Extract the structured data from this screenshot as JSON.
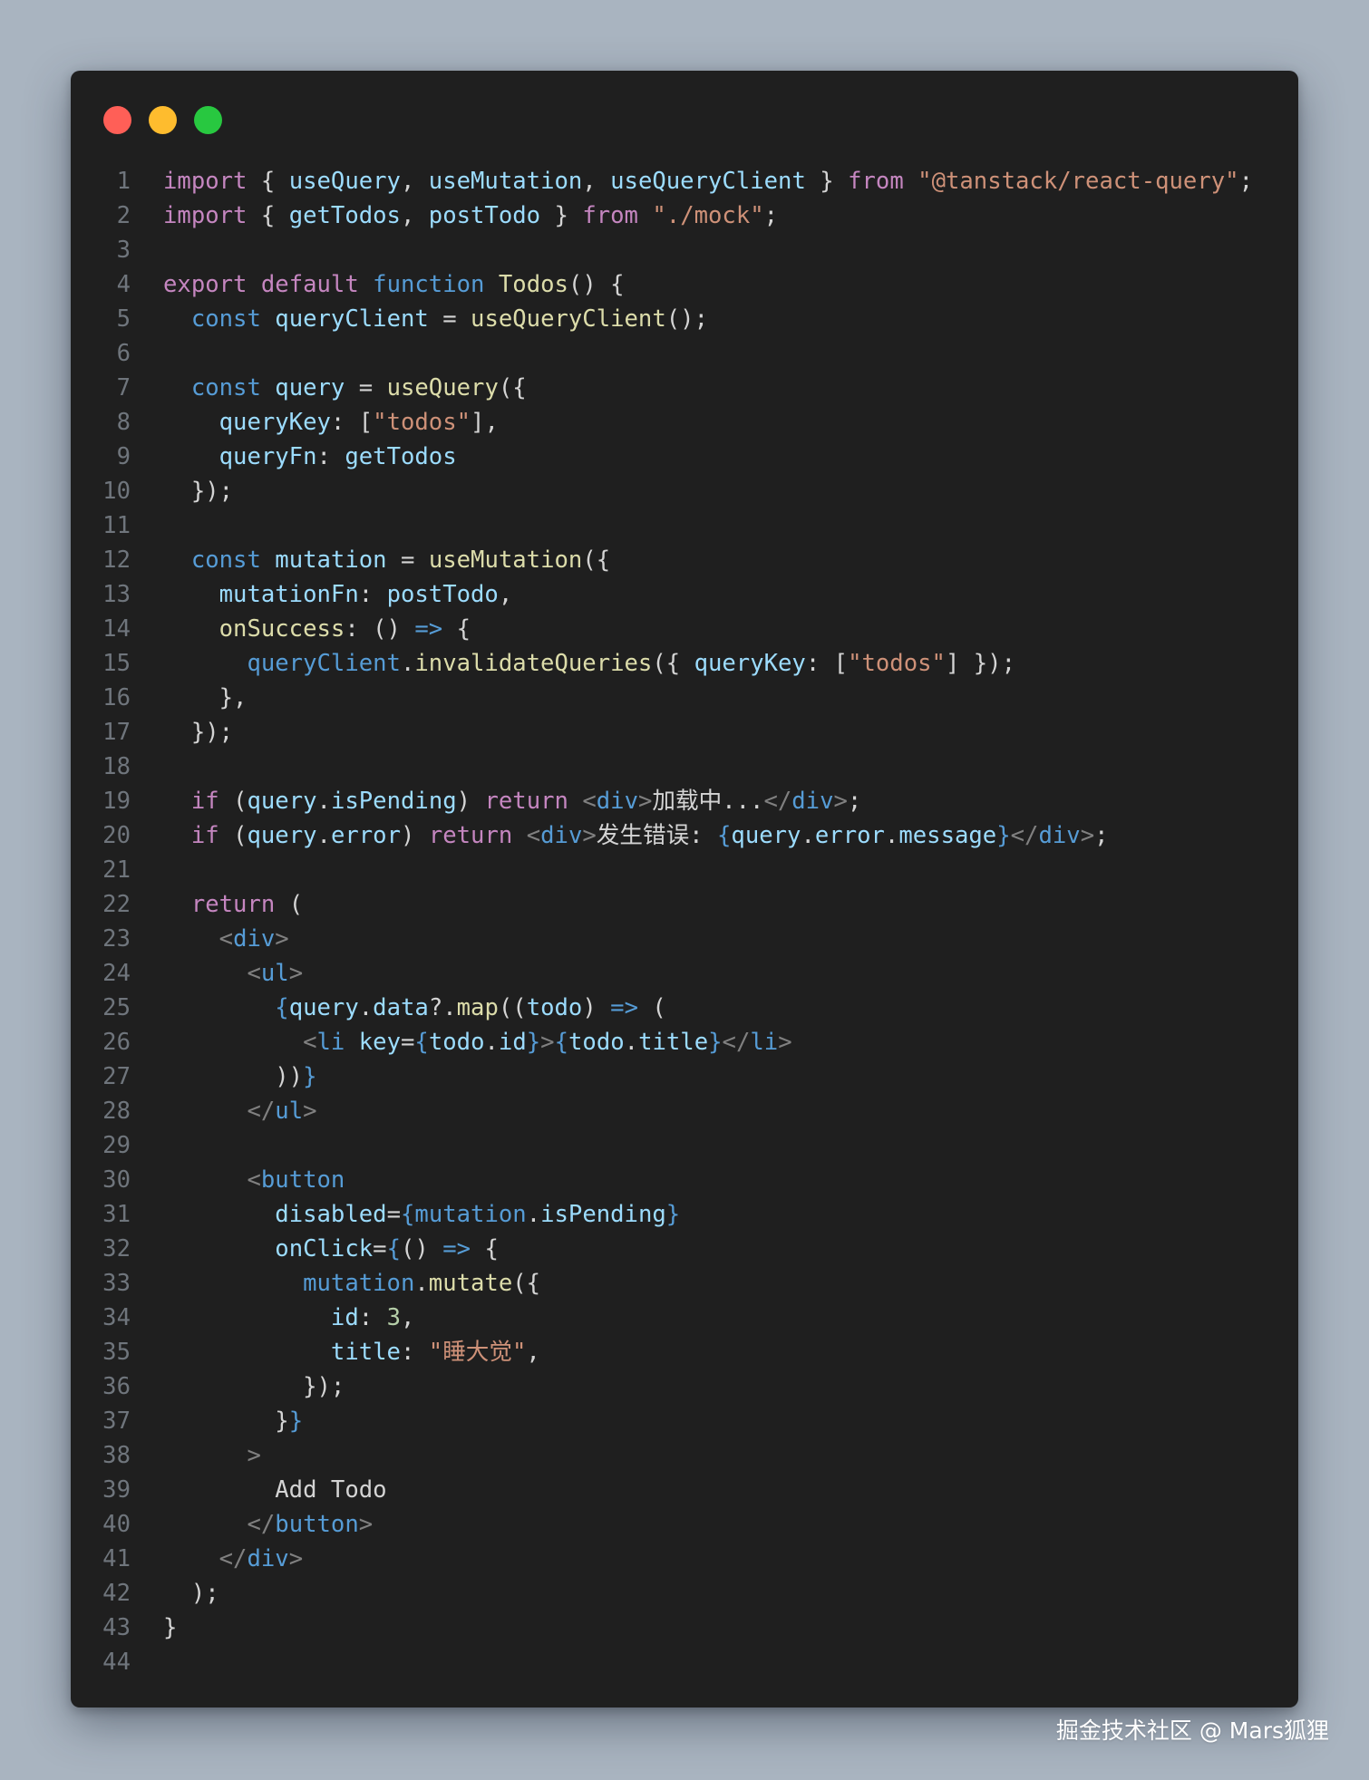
{
  "colors": {
    "keyword": "#c586c0",
    "storage": "#569cd6",
    "variable": "#9cdcfe",
    "function": "#dcdcaa",
    "string": "#ce9178",
    "number": "#b5cea8",
    "punctuation": "#d4d4d4",
    "tag_bracket": "#808080",
    "tag": "#569cd6",
    "jsx_brace": "#569cd6",
    "line_number": "#6f757c",
    "dot_red": "#ff5f57",
    "dot_yellow": "#febc2e",
    "dot_green": "#28c840",
    "window_bg": "#1f1f1f",
    "page_bg": "#a9b4c0"
  },
  "window": {
    "controls": [
      "close",
      "minimize",
      "maximize"
    ]
  },
  "code": {
    "lines": [
      {
        "num": "1",
        "tokens": [
          [
            "kw",
            "import"
          ],
          [
            "p",
            " { "
          ],
          [
            "var",
            "useQuery"
          ],
          [
            "p",
            ", "
          ],
          [
            "var",
            "useMutation"
          ],
          [
            "p",
            ", "
          ],
          [
            "var",
            "useQueryClient"
          ],
          [
            "p",
            " } "
          ],
          [
            "kw",
            "from"
          ],
          [
            "p",
            " "
          ],
          [
            "str",
            "\"@tanstack/react-query\""
          ],
          [
            "p",
            ";"
          ]
        ]
      },
      {
        "num": "2",
        "tokens": [
          [
            "kw",
            "import"
          ],
          [
            "p",
            " { "
          ],
          [
            "var",
            "getTodos"
          ],
          [
            "p",
            ", "
          ],
          [
            "var",
            "postTodo"
          ],
          [
            "p",
            " } "
          ],
          [
            "kw",
            "from"
          ],
          [
            "p",
            " "
          ],
          [
            "str",
            "\"./mock\""
          ],
          [
            "p",
            ";"
          ]
        ]
      },
      {
        "num": "3",
        "tokens": []
      },
      {
        "num": "4",
        "tokens": [
          [
            "kw",
            "export"
          ],
          [
            "p",
            " "
          ],
          [
            "kw",
            "default"
          ],
          [
            "p",
            " "
          ],
          [
            "st",
            "function"
          ],
          [
            "p",
            " "
          ],
          [
            "fn",
            "Todos"
          ],
          [
            "p",
            "() {"
          ]
        ]
      },
      {
        "num": "5",
        "tokens": [
          [
            "p",
            "  "
          ],
          [
            "st",
            "const"
          ],
          [
            "p",
            " "
          ],
          [
            "var",
            "queryClient"
          ],
          [
            "p",
            " = "
          ],
          [
            "fn",
            "useQueryClient"
          ],
          [
            "p",
            "();"
          ]
        ]
      },
      {
        "num": "6",
        "tokens": []
      },
      {
        "num": "7",
        "tokens": [
          [
            "p",
            "  "
          ],
          [
            "st",
            "const"
          ],
          [
            "p",
            " "
          ],
          [
            "var",
            "query"
          ],
          [
            "p",
            " = "
          ],
          [
            "fn",
            "useQuery"
          ],
          [
            "p",
            "({"
          ]
        ]
      },
      {
        "num": "8",
        "tokens": [
          [
            "p",
            "    "
          ],
          [
            "var",
            "queryKey"
          ],
          [
            "p",
            ": ["
          ],
          [
            "str",
            "\"todos\""
          ],
          [
            "p",
            "],"
          ]
        ]
      },
      {
        "num": "9",
        "tokens": [
          [
            "p",
            "    "
          ],
          [
            "var",
            "queryFn"
          ],
          [
            "p",
            ": "
          ],
          [
            "var",
            "getTodos"
          ]
        ]
      },
      {
        "num": "10",
        "tokens": [
          [
            "p",
            "  });"
          ]
        ]
      },
      {
        "num": "11",
        "tokens": []
      },
      {
        "num": "12",
        "tokens": [
          [
            "p",
            "  "
          ],
          [
            "st",
            "const"
          ],
          [
            "p",
            " "
          ],
          [
            "var",
            "mutation"
          ],
          [
            "p",
            " = "
          ],
          [
            "fn",
            "useMutation"
          ],
          [
            "p",
            "({"
          ]
        ]
      },
      {
        "num": "13",
        "tokens": [
          [
            "p",
            "    "
          ],
          [
            "var",
            "mutationFn"
          ],
          [
            "p",
            ": "
          ],
          [
            "var",
            "postTodo"
          ],
          [
            "p",
            ","
          ]
        ]
      },
      {
        "num": "14",
        "tokens": [
          [
            "p",
            "    "
          ],
          [
            "fn",
            "onSuccess"
          ],
          [
            "p",
            ": () "
          ],
          [
            "st",
            "=>"
          ],
          [
            "p",
            " {"
          ]
        ]
      },
      {
        "num": "15",
        "tokens": [
          [
            "p",
            "      "
          ],
          [
            "st",
            "queryClient"
          ],
          [
            "p",
            "."
          ],
          [
            "fn",
            "invalidateQueries"
          ],
          [
            "p",
            "({ "
          ],
          [
            "var",
            "queryKey"
          ],
          [
            "p",
            ": ["
          ],
          [
            "str",
            "\"todos\""
          ],
          [
            "p",
            "] });"
          ]
        ]
      },
      {
        "num": "16",
        "tokens": [
          [
            "p",
            "    },"
          ]
        ]
      },
      {
        "num": "17",
        "tokens": [
          [
            "p",
            "  });"
          ]
        ]
      },
      {
        "num": "18",
        "tokens": []
      },
      {
        "num": "19",
        "tokens": [
          [
            "p",
            "  "
          ],
          [
            "kw",
            "if"
          ],
          [
            "p",
            " ("
          ],
          [
            "var",
            "query"
          ],
          [
            "p",
            "."
          ],
          [
            "var",
            "isPending"
          ],
          [
            "p",
            ") "
          ],
          [
            "kw",
            "return"
          ],
          [
            "p",
            " "
          ],
          [
            "tb",
            "<"
          ],
          [
            "tag",
            "div"
          ],
          [
            "tb",
            ">"
          ],
          [
            "p",
            "加载中..."
          ],
          [
            "tb",
            "</"
          ],
          [
            "tag",
            "div"
          ],
          [
            "tb",
            ">"
          ],
          [
            "p",
            ";"
          ]
        ]
      },
      {
        "num": "20",
        "tokens": [
          [
            "p",
            "  "
          ],
          [
            "kw",
            "if"
          ],
          [
            "p",
            " ("
          ],
          [
            "var",
            "query"
          ],
          [
            "p",
            "."
          ],
          [
            "var",
            "error"
          ],
          [
            "p",
            ") "
          ],
          [
            "kw",
            "return"
          ],
          [
            "p",
            " "
          ],
          [
            "tb",
            "<"
          ],
          [
            "tag",
            "div"
          ],
          [
            "tb",
            ">"
          ],
          [
            "p",
            "发生错误: "
          ],
          [
            "jb",
            "{"
          ],
          [
            "var",
            "query"
          ],
          [
            "p",
            "."
          ],
          [
            "var",
            "error"
          ],
          [
            "p",
            "."
          ],
          [
            "var",
            "message"
          ],
          [
            "jb",
            "}"
          ],
          [
            "tb",
            "</"
          ],
          [
            "tag",
            "div"
          ],
          [
            "tb",
            ">"
          ],
          [
            "p",
            ";"
          ]
        ]
      },
      {
        "num": "21",
        "tokens": []
      },
      {
        "num": "22",
        "tokens": [
          [
            "p",
            "  "
          ],
          [
            "kw",
            "return"
          ],
          [
            "p",
            " ("
          ]
        ]
      },
      {
        "num": "23",
        "tokens": [
          [
            "p",
            "    "
          ],
          [
            "tb",
            "<"
          ],
          [
            "tag",
            "div"
          ],
          [
            "tb",
            ">"
          ]
        ]
      },
      {
        "num": "24",
        "tokens": [
          [
            "p",
            "      "
          ],
          [
            "tb",
            "<"
          ],
          [
            "tag",
            "ul"
          ],
          [
            "tb",
            ">"
          ]
        ]
      },
      {
        "num": "25",
        "tokens": [
          [
            "p",
            "        "
          ],
          [
            "jb",
            "{"
          ],
          [
            "var",
            "query"
          ],
          [
            "p",
            "."
          ],
          [
            "var",
            "data"
          ],
          [
            "p",
            "?."
          ],
          [
            "fn",
            "map"
          ],
          [
            "p",
            "(("
          ],
          [
            "var",
            "todo"
          ],
          [
            "p",
            ") "
          ],
          [
            "st",
            "=>"
          ],
          [
            "p",
            " ("
          ]
        ]
      },
      {
        "num": "26",
        "tokens": [
          [
            "p",
            "          "
          ],
          [
            "tb",
            "<"
          ],
          [
            "tag",
            "li"
          ],
          [
            "p",
            " "
          ],
          [
            "var",
            "key"
          ],
          [
            "p",
            "="
          ],
          [
            "jb",
            "{"
          ],
          [
            "var",
            "todo"
          ],
          [
            "p",
            "."
          ],
          [
            "var",
            "id"
          ],
          [
            "jb",
            "}"
          ],
          [
            "tb",
            ">"
          ],
          [
            "jb",
            "{"
          ],
          [
            "var",
            "todo"
          ],
          [
            "p",
            "."
          ],
          [
            "var",
            "title"
          ],
          [
            "jb",
            "}"
          ],
          [
            "tb",
            "</"
          ],
          [
            "tag",
            "li"
          ],
          [
            "tb",
            ">"
          ]
        ]
      },
      {
        "num": "27",
        "tokens": [
          [
            "p",
            "        ))"
          ],
          [
            "jb",
            "}"
          ]
        ]
      },
      {
        "num": "28",
        "tokens": [
          [
            "p",
            "      "
          ],
          [
            "tb",
            "</"
          ],
          [
            "tag",
            "ul"
          ],
          [
            "tb",
            ">"
          ]
        ]
      },
      {
        "num": "29",
        "tokens": []
      },
      {
        "num": "30",
        "tokens": [
          [
            "p",
            "      "
          ],
          [
            "tb",
            "<"
          ],
          [
            "tag",
            "button"
          ]
        ]
      },
      {
        "num": "31",
        "tokens": [
          [
            "p",
            "        "
          ],
          [
            "var",
            "disabled"
          ],
          [
            "p",
            "="
          ],
          [
            "jb",
            "{"
          ],
          [
            "st",
            "mutation"
          ],
          [
            "p",
            "."
          ],
          [
            "var",
            "isPending"
          ],
          [
            "jb",
            "}"
          ]
        ]
      },
      {
        "num": "32",
        "tokens": [
          [
            "p",
            "        "
          ],
          [
            "var",
            "onClick"
          ],
          [
            "p",
            "="
          ],
          [
            "jb",
            "{"
          ],
          [
            "p",
            "() "
          ],
          [
            "st",
            "=>"
          ],
          [
            "p",
            " {"
          ]
        ]
      },
      {
        "num": "33",
        "tokens": [
          [
            "p",
            "          "
          ],
          [
            "st",
            "mutation"
          ],
          [
            "p",
            "."
          ],
          [
            "fn",
            "mutate"
          ],
          [
            "p",
            "({"
          ]
        ]
      },
      {
        "num": "34",
        "tokens": [
          [
            "p",
            "            "
          ],
          [
            "var",
            "id"
          ],
          [
            "p",
            ": "
          ],
          [
            "num",
            "3"
          ],
          [
            "p",
            ","
          ]
        ]
      },
      {
        "num": "35",
        "tokens": [
          [
            "p",
            "            "
          ],
          [
            "var",
            "title"
          ],
          [
            "p",
            ": "
          ],
          [
            "str",
            "\"睡大觉\""
          ],
          [
            "p",
            ","
          ]
        ]
      },
      {
        "num": "36",
        "tokens": [
          [
            "p",
            "          });"
          ]
        ]
      },
      {
        "num": "37",
        "tokens": [
          [
            "p",
            "        }"
          ],
          [
            "jb",
            "}"
          ]
        ]
      },
      {
        "num": "38",
        "tokens": [
          [
            "p",
            "      "
          ],
          [
            "tb",
            ">"
          ]
        ]
      },
      {
        "num": "39",
        "tokens": [
          [
            "p",
            "        Add Todo"
          ]
        ]
      },
      {
        "num": "40",
        "tokens": [
          [
            "p",
            "      "
          ],
          [
            "tb",
            "</"
          ],
          [
            "tag",
            "button"
          ],
          [
            "tb",
            ">"
          ]
        ]
      },
      {
        "num": "41",
        "tokens": [
          [
            "p",
            "    "
          ],
          [
            "tb",
            "</"
          ],
          [
            "tag",
            "div"
          ],
          [
            "tb",
            ">"
          ]
        ]
      },
      {
        "num": "42",
        "tokens": [
          [
            "p",
            "  );"
          ]
        ]
      },
      {
        "num": "43",
        "tokens": [
          [
            "p",
            "}"
          ]
        ]
      },
      {
        "num": "44",
        "tokens": []
      }
    ]
  },
  "watermark": "掘金技术社区 @ Mars狐狸"
}
